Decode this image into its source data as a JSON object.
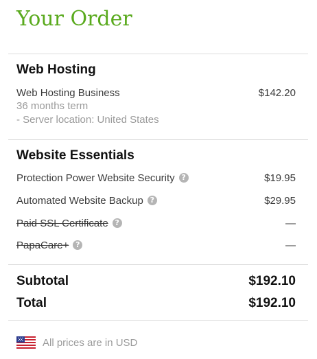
{
  "order": {
    "title": "Your Order"
  },
  "web_hosting": {
    "heading": "Web Hosting",
    "item": {
      "name": "Web Hosting Business",
      "price": "$142.20"
    },
    "term": "36 months term",
    "location": "- Server location: United States"
  },
  "essentials": {
    "heading": "Website Essentials",
    "items": [
      {
        "name": "Protection Power Website Security",
        "price": "$19.95",
        "struck": false,
        "help_icon": "question-circle-icon"
      },
      {
        "name": "Automated Website Backup",
        "price": "$29.95",
        "struck": false,
        "help_icon": "question-circle-icon"
      },
      {
        "name": "Paid SSL Certificate",
        "price": "—",
        "struck": true,
        "help_icon": "question-circle-icon"
      },
      {
        "name": "PapaCare+",
        "price": "—",
        "struck": true,
        "help_icon": "question-circle-icon"
      }
    ]
  },
  "totals": {
    "subtotal_label": "Subtotal",
    "subtotal_value": "$192.10",
    "total_label": "Total",
    "total_value": "$192.10"
  },
  "footer": {
    "text": "All prices are in USD",
    "flag_icon": "us-flag-icon"
  },
  "colors": {
    "title": "#5aaa1e",
    "help_icon": "#b5b5b5",
    "divider": "#dcdcdc"
  }
}
